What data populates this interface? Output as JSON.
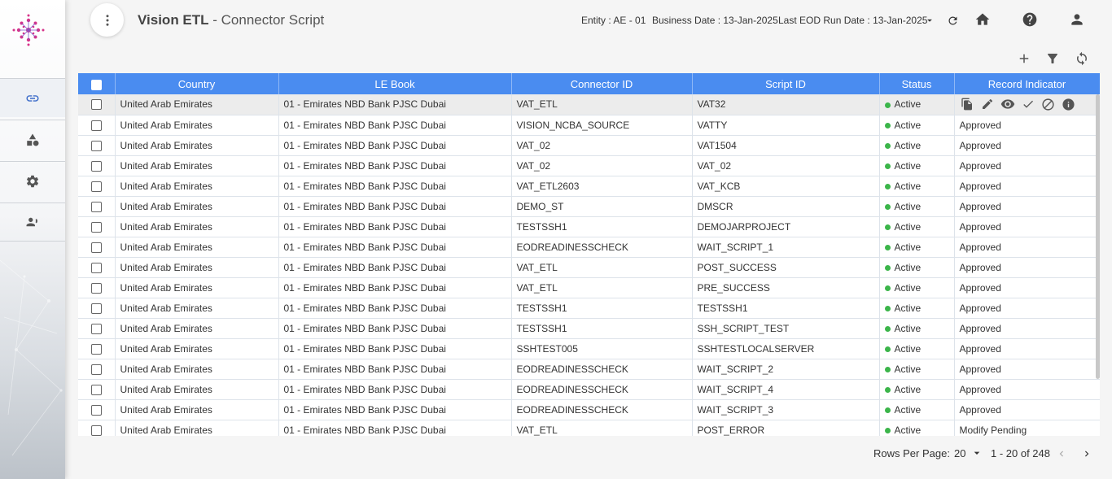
{
  "header": {
    "app_name": "Vision ETL",
    "page_title": " - Connector Script",
    "entity_label": "Entity : ",
    "entity_value": "AE - 01",
    "business_date_label": "Business Date : ",
    "business_date_value": "13-Jan-2025",
    "eod_label": "Last EOD Run Date : ",
    "eod_value": "13-Jan-2025"
  },
  "sidebar": {
    "items": [
      {
        "name": "link-icon"
      },
      {
        "name": "shapes-icon"
      },
      {
        "name": "gear-icon"
      },
      {
        "name": "users-icon"
      }
    ]
  },
  "table": {
    "columns": [
      "Country",
      "LE Book",
      "Connector ID",
      "Script ID",
      "Status",
      "Record Indicator"
    ],
    "rows": [
      [
        "United Arab Emirates",
        "01 - Emirates NBD Bank PJSC Dubai",
        "VAT_ETL",
        "VAT32",
        "Active",
        ""
      ],
      [
        "United Arab Emirates",
        "01 - Emirates NBD Bank PJSC Dubai",
        "VISION_NCBA_SOURCE",
        "VATTY",
        "Active",
        "Approved"
      ],
      [
        "United Arab Emirates",
        "01 - Emirates NBD Bank PJSC Dubai",
        "VAT_02",
        "VAT1504",
        "Active",
        "Approved"
      ],
      [
        "United Arab Emirates",
        "01 - Emirates NBD Bank PJSC Dubai",
        "VAT_02",
        "VAT_02",
        "Active",
        "Approved"
      ],
      [
        "United Arab Emirates",
        "01 - Emirates NBD Bank PJSC Dubai",
        "VAT_ETL2603",
        "VAT_KCB",
        "Active",
        "Approved"
      ],
      [
        "United Arab Emirates",
        "01 - Emirates NBD Bank PJSC Dubai",
        "DEMO_ST",
        "DMSCR",
        "Active",
        "Approved"
      ],
      [
        "United Arab Emirates",
        "01 - Emirates NBD Bank PJSC Dubai",
        "TESTSSH1",
        "DEMOJARPROJECT",
        "Active",
        "Approved"
      ],
      [
        "United Arab Emirates",
        "01 - Emirates NBD Bank PJSC Dubai",
        "EODREADINESSCHECK",
        "WAIT_SCRIPT_1",
        "Active",
        "Approved"
      ],
      [
        "United Arab Emirates",
        "01 - Emirates NBD Bank PJSC Dubai",
        "VAT_ETL",
        "POST_SUCCESS",
        "Active",
        "Approved"
      ],
      [
        "United Arab Emirates",
        "01 - Emirates NBD Bank PJSC Dubai",
        "VAT_ETL",
        "PRE_SUCCESS",
        "Active",
        "Approved"
      ],
      [
        "United Arab Emirates",
        "01 - Emirates NBD Bank PJSC Dubai",
        "TESTSSH1",
        "TESTSSH1",
        "Active",
        "Approved"
      ],
      [
        "United Arab Emirates",
        "01 - Emirates NBD Bank PJSC Dubai",
        "TESTSSH1",
        "SSH_SCRIPT_TEST",
        "Active",
        "Approved"
      ],
      [
        "United Arab Emirates",
        "01 - Emirates NBD Bank PJSC Dubai",
        "SSHTEST005",
        "SSHTESTLOCALSERVER",
        "Active",
        "Approved"
      ],
      [
        "United Arab Emirates",
        "01 - Emirates NBD Bank PJSC Dubai",
        "EODREADINESSCHECK",
        "WAIT_SCRIPT_2",
        "Active",
        "Approved"
      ],
      [
        "United Arab Emirates",
        "01 - Emirates NBD Bank PJSC Dubai",
        "EODREADINESSCHECK",
        "WAIT_SCRIPT_4",
        "Active",
        "Approved"
      ],
      [
        "United Arab Emirates",
        "01 - Emirates NBD Bank PJSC Dubai",
        "EODREADINESSCHECK",
        "WAIT_SCRIPT_3",
        "Active",
        "Approved"
      ],
      [
        "United Arab Emirates",
        "01 - Emirates NBD Bank PJSC Dubai",
        "VAT_ETL",
        "POST_ERROR",
        "Active",
        "Modify Pending"
      ]
    ],
    "row_actions": [
      "copy-icon",
      "edit-icon",
      "view-icon",
      "approve-icon",
      "reject-icon",
      "info-icon"
    ],
    "status_color": "#3bb54a",
    "header_color": "#4a8cf0"
  },
  "pagination": {
    "rows_per_page_label": "Rows Per Page:",
    "rows_per_page_value": "20",
    "range": "1 - 20 of 248"
  }
}
